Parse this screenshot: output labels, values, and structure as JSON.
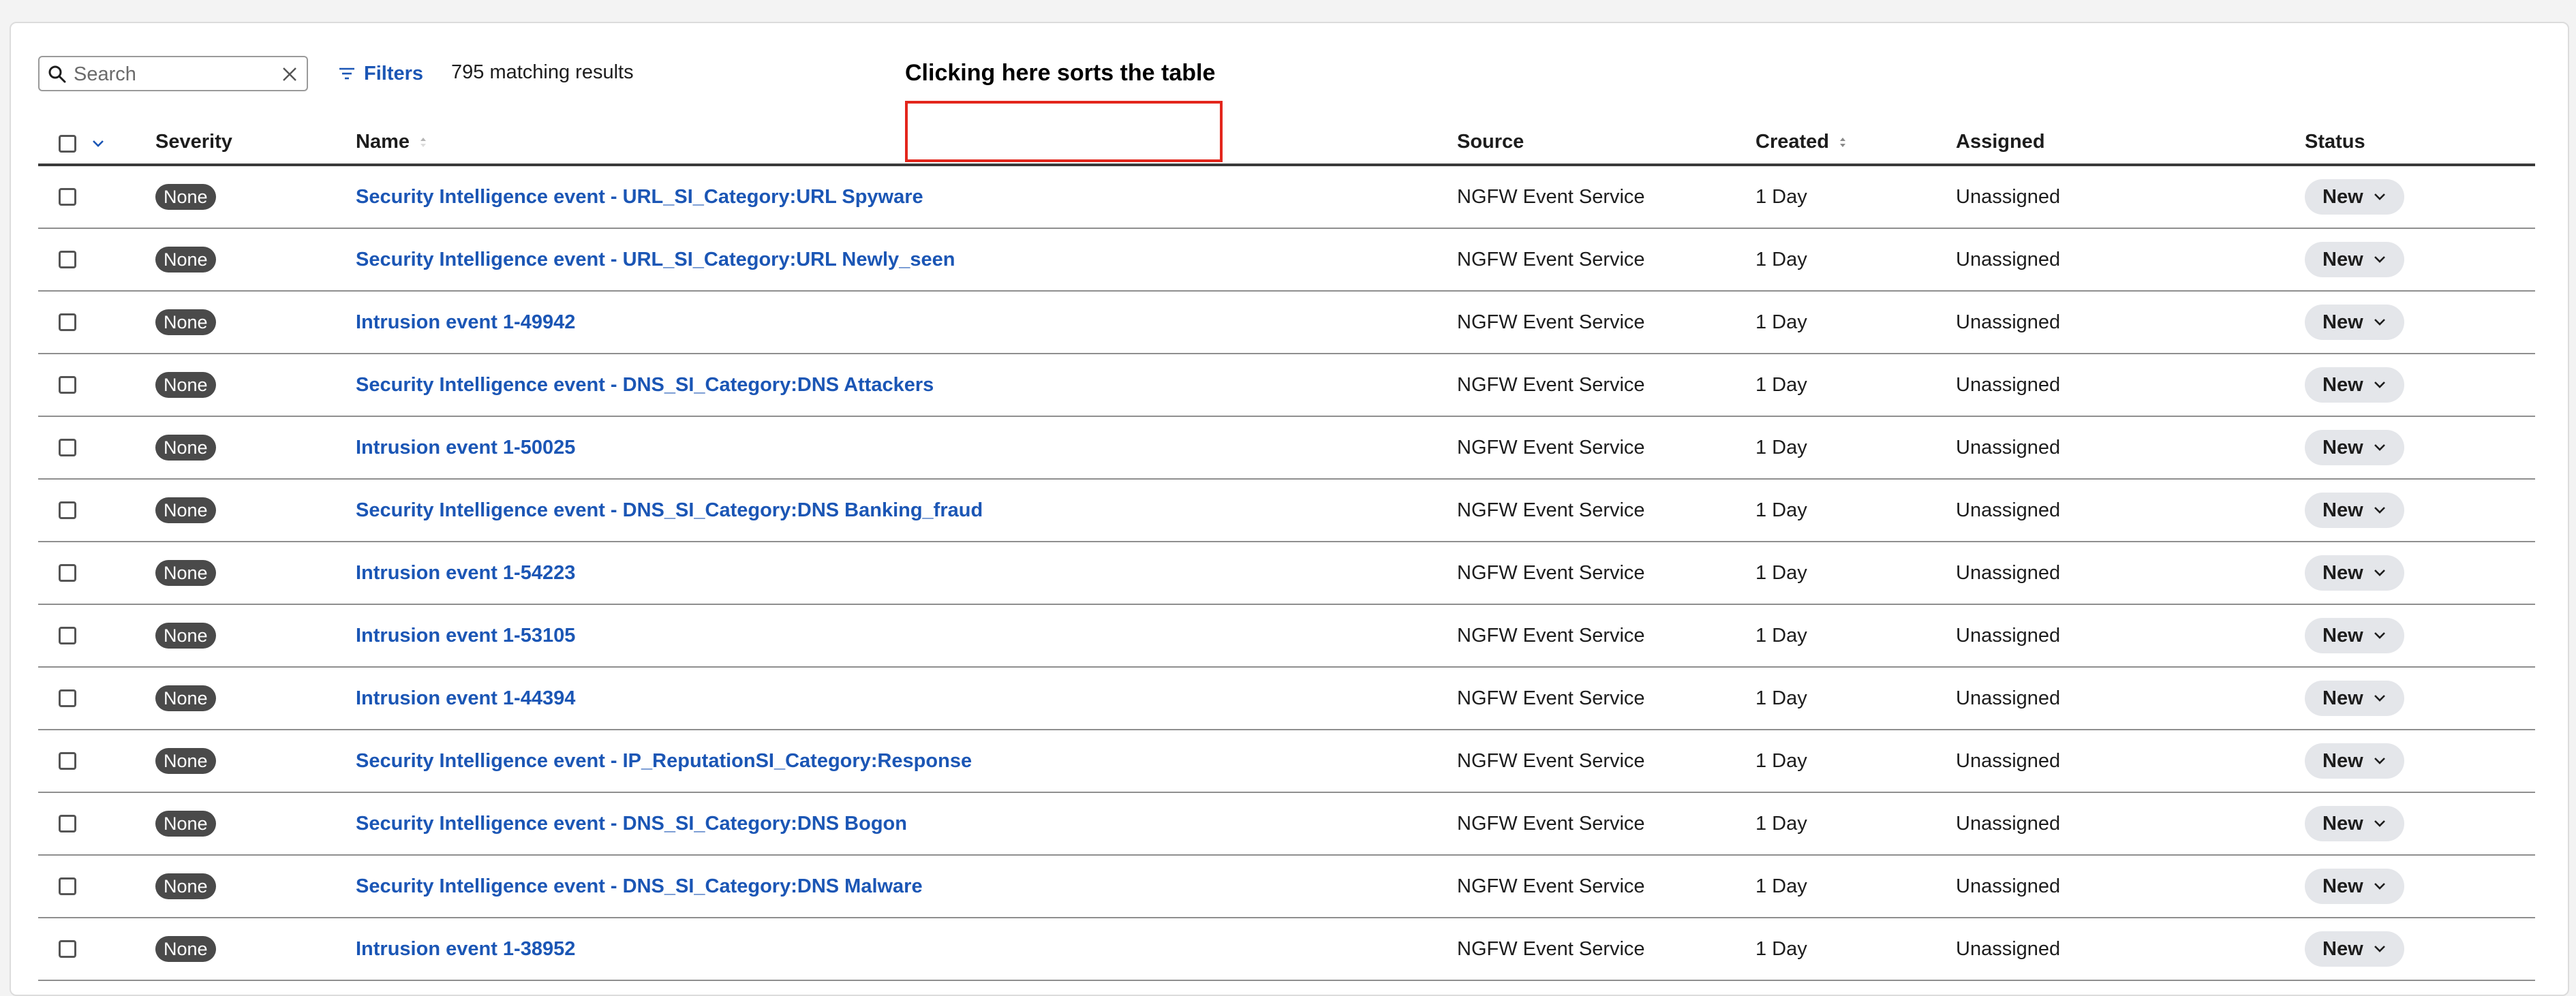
{
  "toolbar": {
    "search_placeholder": "Search",
    "filters_label": "Filters",
    "results_text": "795 matching results"
  },
  "annotation": {
    "text": "Clicking here sorts the table"
  },
  "columns": {
    "severity": "Severity",
    "name": "Name",
    "source": "Source",
    "created": "Created",
    "assigned": "Assigned",
    "status": "Status"
  },
  "rows": [
    {
      "severity": "None",
      "name": "Security Intelligence event - URL_SI_Category:URL Spyware",
      "source": "NGFW Event Service",
      "created": "1 Day",
      "assigned": "Unassigned",
      "status": "New"
    },
    {
      "severity": "None",
      "name": "Security Intelligence event - URL_SI_Category:URL Newly_seen",
      "source": "NGFW Event Service",
      "created": "1 Day",
      "assigned": "Unassigned",
      "status": "New"
    },
    {
      "severity": "None",
      "name": "Intrusion event 1-49942",
      "source": "NGFW Event Service",
      "created": "1 Day",
      "assigned": "Unassigned",
      "status": "New"
    },
    {
      "severity": "None",
      "name": "Security Intelligence event - DNS_SI_Category:DNS Attackers",
      "source": "NGFW Event Service",
      "created": "1 Day",
      "assigned": "Unassigned",
      "status": "New"
    },
    {
      "severity": "None",
      "name": "Intrusion event 1-50025",
      "source": "NGFW Event Service",
      "created": "1 Day",
      "assigned": "Unassigned",
      "status": "New"
    },
    {
      "severity": "None",
      "name": "Security Intelligence event - DNS_SI_Category:DNS Banking_fraud",
      "source": "NGFW Event Service",
      "created": "1 Day",
      "assigned": "Unassigned",
      "status": "New"
    },
    {
      "severity": "None",
      "name": "Intrusion event 1-54223",
      "source": "NGFW Event Service",
      "created": "1 Day",
      "assigned": "Unassigned",
      "status": "New"
    },
    {
      "severity": "None",
      "name": "Intrusion event 1-53105",
      "source": "NGFW Event Service",
      "created": "1 Day",
      "assigned": "Unassigned",
      "status": "New"
    },
    {
      "severity": "None",
      "name": "Intrusion event 1-44394",
      "source": "NGFW Event Service",
      "created": "1 Day",
      "assigned": "Unassigned",
      "status": "New"
    },
    {
      "severity": "None",
      "name": "Security Intelligence event - IP_ReputationSI_Category:Response",
      "source": "NGFW Event Service",
      "created": "1 Day",
      "assigned": "Unassigned",
      "status": "New"
    },
    {
      "severity": "None",
      "name": "Security Intelligence event - DNS_SI_Category:DNS Bogon",
      "source": "NGFW Event Service",
      "created": "1 Day",
      "assigned": "Unassigned",
      "status": "New"
    },
    {
      "severity": "None",
      "name": "Security Intelligence event - DNS_SI_Category:DNS Malware",
      "source": "NGFW Event Service",
      "created": "1 Day",
      "assigned": "Unassigned",
      "status": "New"
    },
    {
      "severity": "None",
      "name": "Intrusion event 1-38952",
      "source": "NGFW Event Service",
      "created": "1 Day",
      "assigned": "Unassigned",
      "status": "New"
    }
  ],
  "colors": {
    "link": "#1b56b5",
    "annotation": "#e3261c",
    "badge": "#4a4a4a",
    "status_pill": "#e4e6ea"
  }
}
